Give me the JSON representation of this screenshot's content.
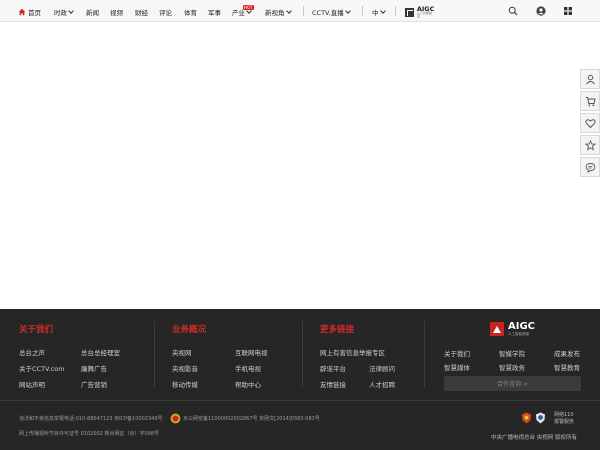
{
  "nav": {
    "home": "首页",
    "items": [
      "时政",
      "新闻",
      "视频",
      "财经",
      "评论",
      "体育",
      "军事",
      "产业",
      "新视角",
      "CCTV.直播",
      "中"
    ],
    "hot_badge": "HOT",
    "aigc_logo_text": "AIGC",
    "aigc_logo_sub": "人工智能频道",
    "icons": [
      "search-icon",
      "user-icon",
      "grid-icon"
    ]
  },
  "side_tools": [
    "user-icon",
    "cart-icon",
    "heart-icon",
    "star-icon",
    "chat-icon"
  ],
  "footer": {
    "col1": {
      "title": "关于我们",
      "links": [
        "总台之声",
        "总台总经理室",
        "关于CCTV.com",
        "廉舞广告",
        "网站声明",
        "广告营销"
      ]
    },
    "col2": {
      "title": "业务概况",
      "links": [
        "央视网",
        "互联网电视",
        "央视影音",
        "手机电视",
        "移动传媒",
        "帮助中心"
      ]
    },
    "col3": {
      "title": "更多链接",
      "links": [
        "网上有害信息举报专区",
        "辟谣平台",
        "法律顾问",
        "友情链接",
        "人才招聘"
      ]
    },
    "aigc": {
      "logo_text": "AIGC",
      "logo_sub": "人工智能频道",
      "links": [
        "关于我们",
        "智媒学院",
        "成果发布",
        "智慧媒体",
        "智慧政务",
        "智慧教育"
      ],
      "consult": "合作咨询 >"
    },
    "legal1": "违法和不良信息举报电话:010-88047123 京ICP备10002349号",
    "legal1b": "京公网安备11000002002867号  京网文[2014]0383-083号",
    "legal2": "网上传播视听节目许可证号 0102002  新出网证（京）字098号",
    "report_line1": "网络110",
    "report_line2": "报警服务",
    "copyright": "中央广播电视总台 央视网 版权所有"
  },
  "colors": {
    "accent_red": "#d22b2b",
    "footer_bg": "#262626",
    "nav_bg": "#f7f7f7"
  }
}
